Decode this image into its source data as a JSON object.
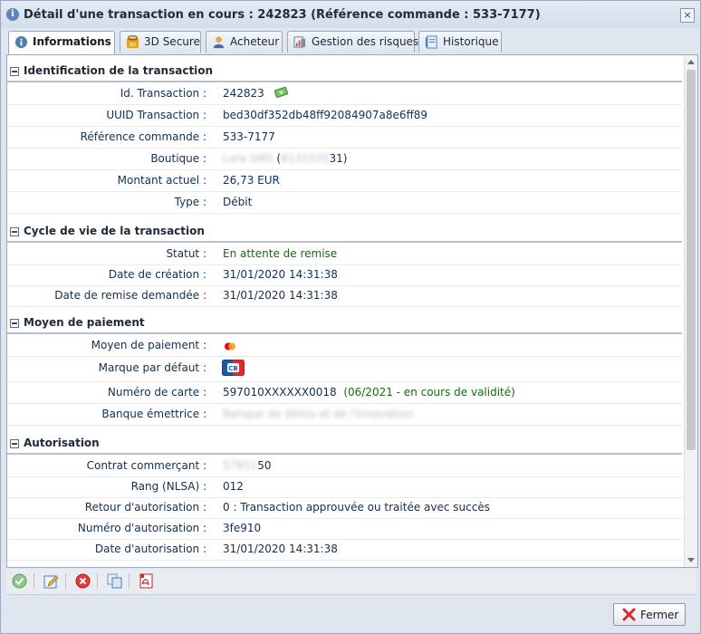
{
  "window": {
    "title": "Détail d'une transaction en cours : 242823 (Référence commande : 533-7177)",
    "close_label": "×"
  },
  "tabs": [
    {
      "label": "Informations",
      "icon": "info-icon",
      "active": true
    },
    {
      "label": "3D Secure",
      "icon": "3d-secure-icon",
      "active": false
    },
    {
      "label": "Acheteur",
      "icon": "buyer-icon",
      "active": false
    },
    {
      "label": "Gestion des risques",
      "icon": "risk-icon",
      "active": false
    },
    {
      "label": "Historique",
      "icon": "history-icon",
      "active": false
    }
  ],
  "sections": {
    "identification": {
      "title": "Identification de la transaction",
      "rows": [
        {
          "label": "Id. Transaction :",
          "value": "242823"
        },
        {
          "label": "UUID Transaction :",
          "value": "bed30df352db48ff92084907a8e6ff89"
        },
        {
          "label": "Référence commande :",
          "value": "533-7177"
        },
        {
          "label": "Boutique :",
          "value_blur": "Lora SMS",
          "value_sep": " (",
          "value_blur2": "8131555",
          "value_tail": "31)"
        },
        {
          "label": "Montant actuel :",
          "value": "26,73 EUR"
        },
        {
          "label": "Type :",
          "value": "Débit"
        }
      ]
    },
    "lifecycle": {
      "title": "Cycle de vie de la transaction",
      "rows": [
        {
          "label": "Statut :",
          "value": "En attente de remise"
        },
        {
          "label": "Date de création :",
          "value": "31/01/2020 14:31:38"
        },
        {
          "label": "Date de remise demandée :",
          "value": "31/01/2020 14:31:38"
        }
      ]
    },
    "payment": {
      "title": "Moyen de paiement",
      "rows": [
        {
          "label": "Moyen de paiement :",
          "value": ""
        },
        {
          "label": "Marque par défaut :",
          "value": ""
        },
        {
          "label": "Numéro de carte :",
          "value": "597010XXXXXX0018",
          "value_extra": "(06/2021 - en cours de validité)"
        },
        {
          "label": "Banque émettrice :",
          "value_blur": "Banque de démo et de l'innovation"
        }
      ]
    },
    "authorisation": {
      "title": "Autorisation",
      "rows": [
        {
          "label": "Contrat commerçant :",
          "value_blur": "57851",
          "value_tail": "50"
        },
        {
          "label": "Rang (NLSA) :",
          "value": "012"
        },
        {
          "label": "Retour d'autorisation :",
          "value": "0 : Transaction approuvée ou traitée avec succès"
        },
        {
          "label": "Numéro d'autorisation :",
          "value": "3fe910"
        },
        {
          "label": "Date d'autorisation :",
          "value": "31/01/2020 14:31:38"
        }
      ]
    }
  },
  "toolbar": {
    "buttons": [
      "validate-icon",
      "edit-icon",
      "cancel-icon",
      "duplicate-icon",
      "pdf-icon"
    ]
  },
  "footer": {
    "close_button_label": "Fermer"
  },
  "colors": {
    "label": "#12304e",
    "status_green": "#176b14",
    "window_bg": "#dfe6ef"
  }
}
